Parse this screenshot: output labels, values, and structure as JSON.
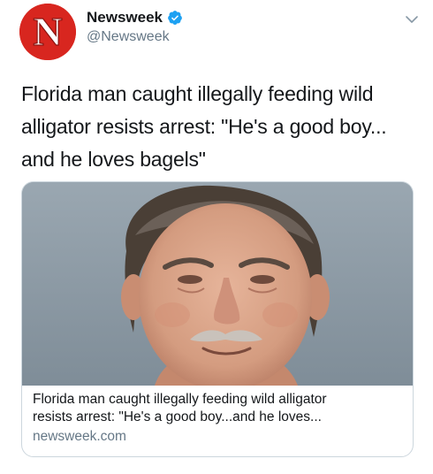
{
  "tweet": {
    "author": {
      "display_name": "Newsweek",
      "handle": "@Newsweek",
      "verified": true,
      "avatar_letter": "N",
      "avatar_color": "#d8261f"
    },
    "text_lines": [
      "Florida man caught illegally feeding wild",
      "alligator resists arrest: \"He's a good boy...",
      "and he loves bagels\""
    ],
    "card": {
      "title_lines": [
        "Florida man caught illegally feeding wild alligator",
        "resists arrest: \"He's a good boy...and he loves..."
      ],
      "domain": "newsweek.com",
      "image_icon": "mugshot-photo"
    }
  },
  "colors": {
    "text_primary": "#14171a",
    "text_secondary": "#657786",
    "verified_blue": "#1da1f2",
    "card_border": "#ccd6dd"
  }
}
